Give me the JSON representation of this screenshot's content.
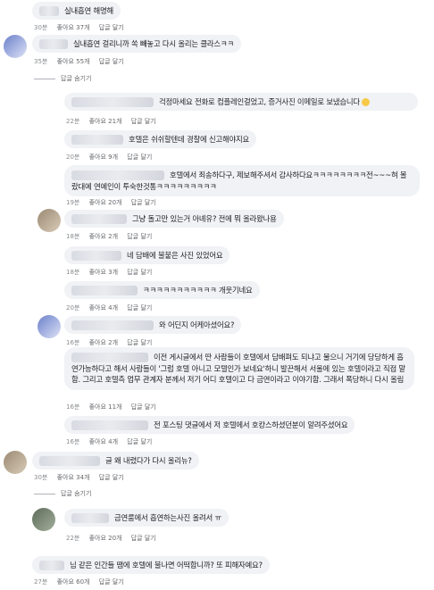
{
  "labels": {
    "like": "좋아요",
    "reply": "답글 달기",
    "hide_replies": "답글 숨기기"
  },
  "comments": [
    {
      "text": "실내흡연 해명해",
      "time": "30분",
      "likes": "좋아요 37개"
    },
    {
      "text": "실내흡연 걸리니까 쏙 빼놓고 다시 올리는 클라스ㅋㅋ",
      "time": "35분",
      "likes": "좋아요 55개"
    },
    {
      "text": "걱정마세요 전화로 컴플레인걸었고, 증거사진 이메일로 보냈습니다",
      "time": "22분",
      "likes": "좋아요 21개"
    },
    {
      "text": "호텔은 쉬쉬할텐데 경찰에 신고해야지요",
      "time": "20분",
      "likes": "좋아요 9개"
    },
    {
      "text": "호텔에서 죄송하다구, 제보해주셔서 감사하다요ㅋㅋㅋㅋㅋㅋㅋㅋ전~~~혀 몰랐대예 연예인이 투숙한것통ㅋㅋㅋㅋㅋㅋㅋㅋㅋ",
      "time": "19분",
      "likes": "좋아요 20개"
    },
    {
      "text": "그냥 돌고만 있는거 아녜유? 전에 뭐 올라왔나용",
      "time": "18분",
      "likes": "좋아요 2개"
    },
    {
      "text": "네 담배에 불붙은 사진 있었어요",
      "time": "18분",
      "likes": "좋아요 3개"
    },
    {
      "text": "ㅋㅋㅋㅋㅋㅋㅋㅋㅋㅋㅋ 개웃기네요",
      "time": "20분",
      "likes": "좋아요 4개"
    },
    {
      "text": "와 어딘지 어케아셨어요?",
      "time": "16분",
      "likes": "좋아요 2개"
    },
    {
      "text": "이전 게시글에서 딴 사람들이 호텔에서 담배펴도 되냐고 물으니 거기에 당당하게 흡연가능하다고 해서 사람들이 '그럼 호텔 아니고 모텔인가 보네요'하니 발끈해서 서울에 있는 호텔이라고 직접 말함. 그리고 호텔측 업무 관계자 분께서 저기 어디 호텔이고 다 금연이라고 이야기함. 그래서 폭당하니 다시 올림",
      "time": "16분",
      "likes": "좋아요 11개"
    },
    {
      "text": "전 포스팅 댓글에서 저 호텔에서 호캉스하셨던분이 알려주셨어요",
      "time": "16분",
      "likes": "좋아요 4개"
    },
    {
      "text": "글 왜 내렸다가 다시 올리뉴?",
      "time": "30분",
      "likes": "좋아요 34개"
    },
    {
      "text": "금연룸에서 흡연하는사진 올려서 ㅠ",
      "time": "22분",
      "likes": "좋아요 20개"
    },
    {
      "text": "님 같은 인간들 땜에 호텔에 불나면 어떡합니까? 또 피해자예요?",
      "time": "27분",
      "likes": "좋아요 60개"
    }
  ]
}
